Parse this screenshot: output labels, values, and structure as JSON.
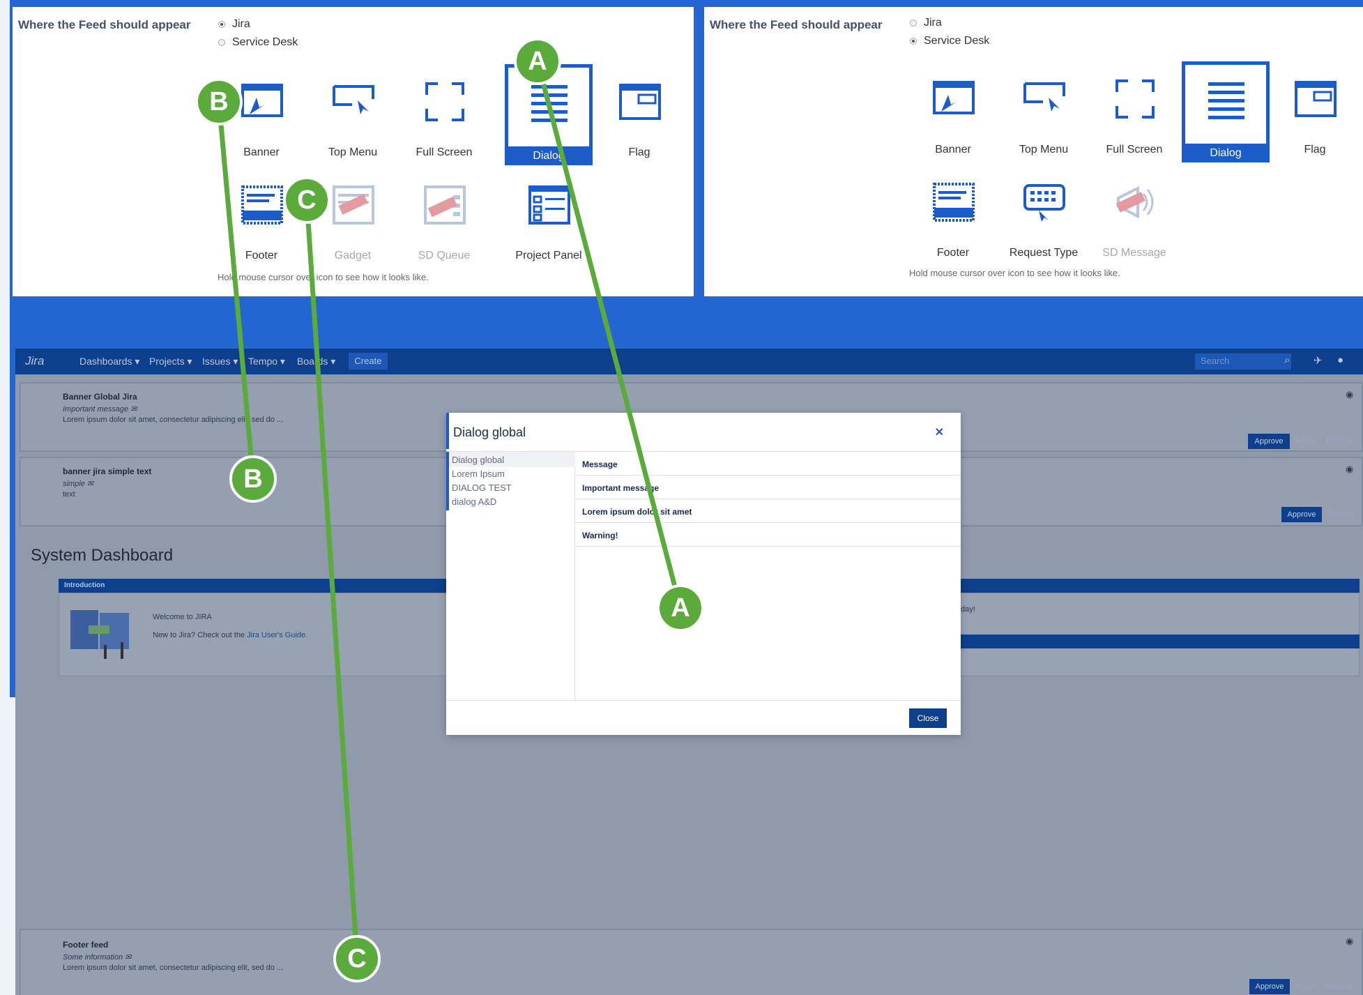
{
  "config_left": {
    "label": "Where the Feed should appear",
    "radio_options": [
      "Jira",
      "Service Desk"
    ],
    "selected": "Jira",
    "options": [
      {
        "label": "Banner",
        "icon": "banner-icon"
      },
      {
        "label": "Top Menu",
        "icon": "top-menu-icon"
      },
      {
        "label": "Full Screen",
        "icon": "full-screen-icon"
      },
      {
        "label": "Dialog",
        "icon": "dialog-icon",
        "selected": true
      },
      {
        "label": "Flag",
        "icon": "flag-icon"
      },
      {
        "label": "Footer",
        "icon": "footer-icon"
      },
      {
        "label": "Gadget",
        "icon": "gadget-icon",
        "disabled": true
      },
      {
        "label": "SD Queue",
        "icon": "sd-queue-icon",
        "disabled": true
      },
      {
        "label": "Project Panel",
        "icon": "project-panel-icon"
      }
    ],
    "hint": "Hold mouse cursor over icon to see how it looks like."
  },
  "config_right": {
    "label": "Where the Feed should appear",
    "radio_options": [
      "Jira",
      "Service Desk"
    ],
    "selected": "Service Desk",
    "options": [
      {
        "label": "Banner",
        "icon": "banner-icon"
      },
      {
        "label": "Top Menu",
        "icon": "top-menu-icon"
      },
      {
        "label": "Full Screen",
        "icon": "full-screen-icon"
      },
      {
        "label": "Dialog",
        "icon": "dialog-icon",
        "selected": true
      },
      {
        "label": "Flag",
        "icon": "flag-icon"
      },
      {
        "label": "Footer",
        "icon": "footer-icon"
      },
      {
        "label": "Request Type",
        "icon": "keyboard-icon"
      },
      {
        "label": "SD Message",
        "icon": "megaphone-icon",
        "disabled": true
      }
    ],
    "hint": "Hold mouse cursor over icon to see how it looks like."
  },
  "jira_nav": {
    "logo": "Jira",
    "items": [
      "Dashboards ▾",
      "Projects ▾",
      "Issues ▾",
      "Tempo ▾",
      "Boards ▾"
    ],
    "create": "Create",
    "search_placeholder": "Search"
  },
  "feeds": {
    "banner_global": {
      "title": "Banner Global Jira",
      "subtitle": "Important message ✉",
      "body": "Lorem ipsum dolor sit amet, consectetur adipiscing elit, sed do ..."
    },
    "banner_simple": {
      "title": "banner jira simple text",
      "subtitle": "simple ✉",
      "body": "text"
    },
    "footer": {
      "title": "Footer feed",
      "subtitle": "Some information ✉",
      "body": "Lorem ipsum dolor sit amet, consectetur adipiscing elit, sed do ..."
    },
    "approve": "Approve",
    "reject": "Reject",
    "dismiss": "Dismiss"
  },
  "dashboard": {
    "title": "System Dashboard",
    "intro_header": "Introduction",
    "welcome": "Welcome to JIRA",
    "new_to": "New to Jira? Check out the",
    "guide_link": "Jira User's Guide.",
    "right_snippet": "day!"
  },
  "dialog": {
    "title": "Dialog global",
    "nav_items": [
      "Dialog global",
      "Lorem Ipsum",
      "DIALOG TEST",
      "dialog A&D"
    ],
    "rows": [
      "Message",
      "Important message",
      "Lorem ipsum dolor sit amet",
      "Warning!"
    ],
    "close_label": "Close"
  },
  "annotations": {
    "a": "A",
    "b": "B",
    "c": "C",
    "color": "#5aab3b"
  }
}
